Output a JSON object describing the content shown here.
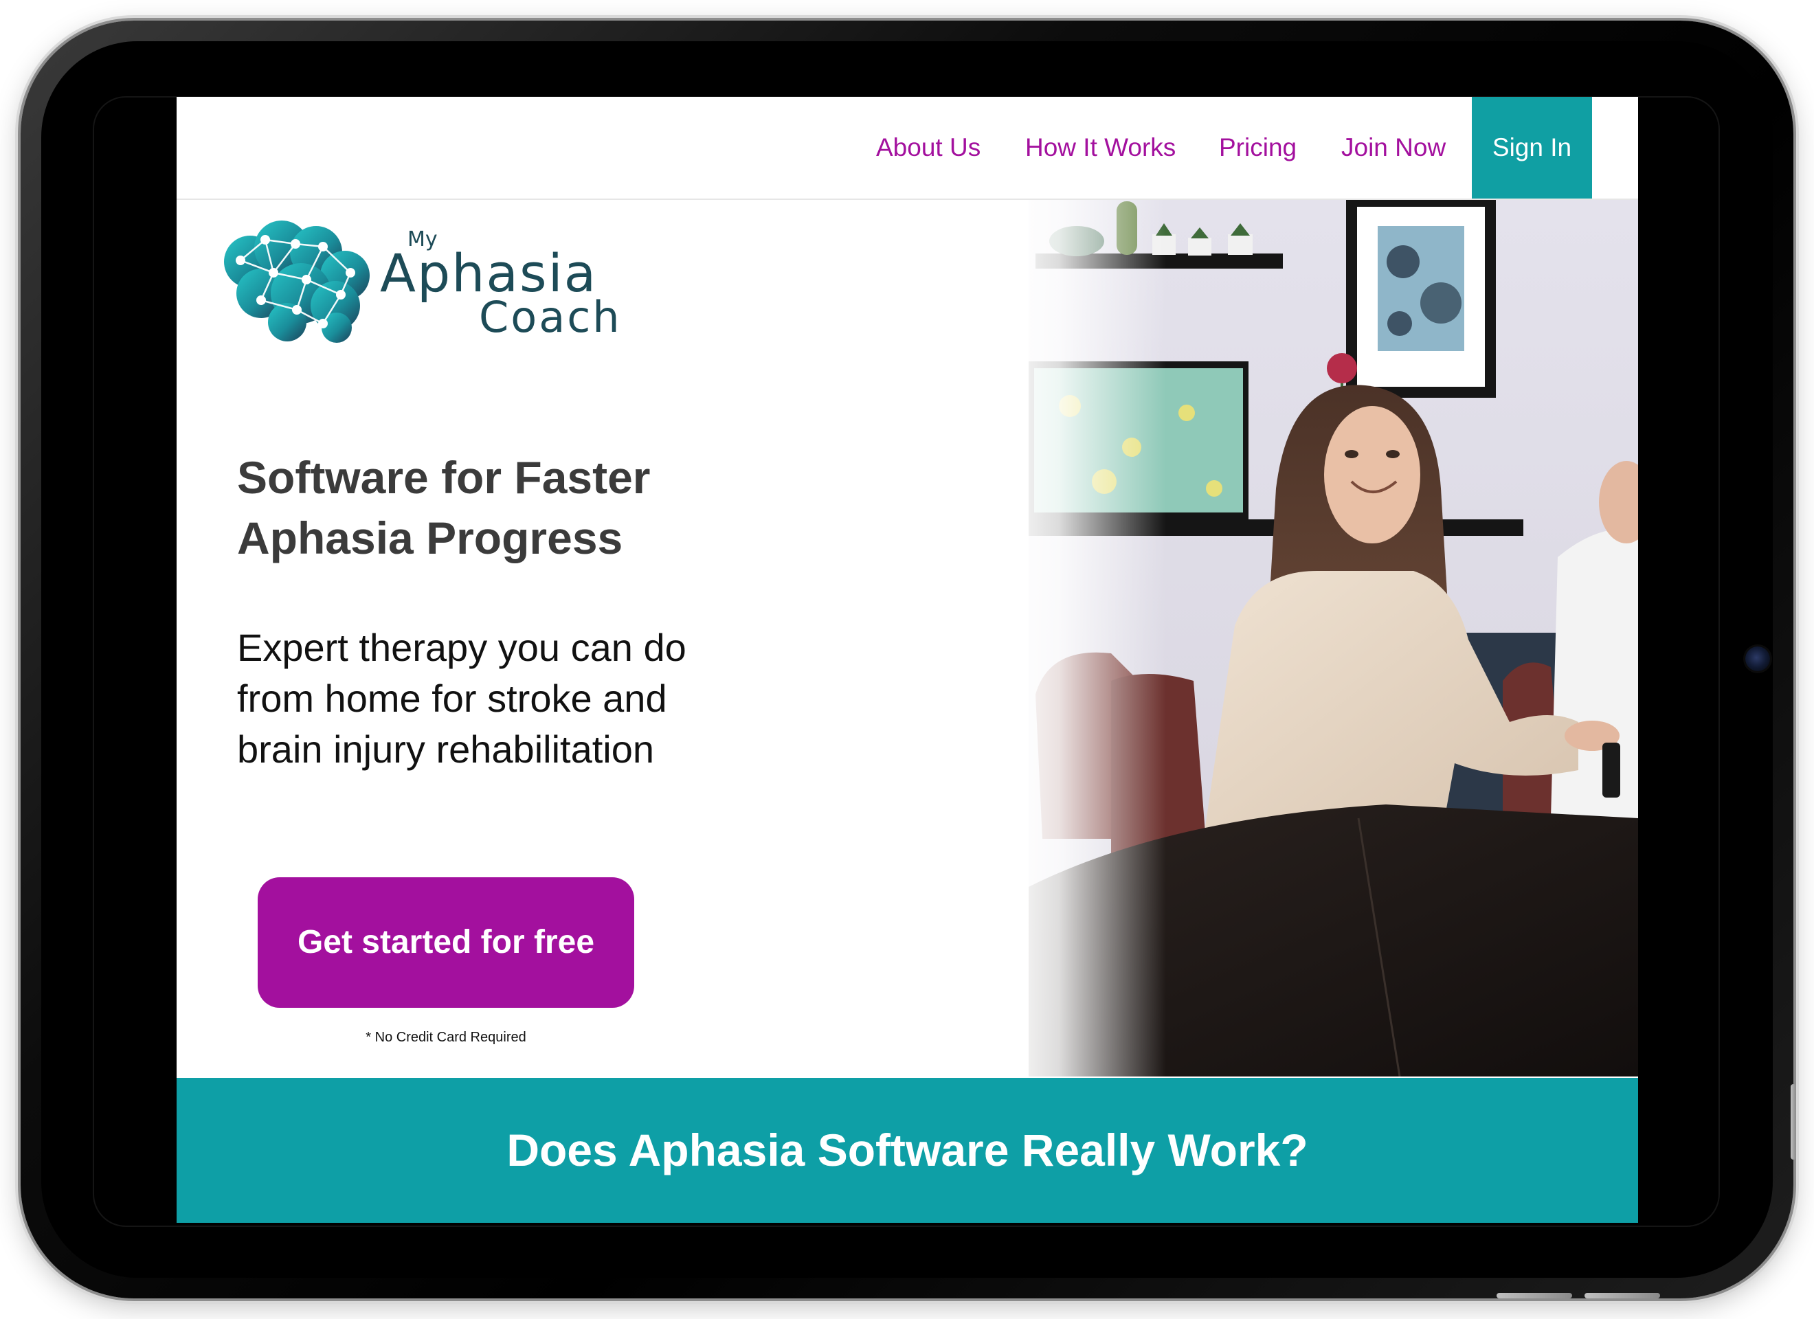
{
  "nav": {
    "items": [
      {
        "label": "About Us"
      },
      {
        "label": "How It Works"
      },
      {
        "label": "Pricing"
      },
      {
        "label": "Join Now"
      }
    ],
    "sign_in": "Sign In"
  },
  "logo": {
    "my": "My",
    "aphasia": "Aphasia",
    "coach": "Coach"
  },
  "hero": {
    "headline_line1": "Software for Faster",
    "headline_line2": "Aphasia Progress",
    "sub_line1": "Expert therapy you can do",
    "sub_line2": "from home for stroke and",
    "sub_line3": "brain injury rehabilitation",
    "cta_label": "Get started for free",
    "cta_note": "* No Credit Card Required"
  },
  "banner": {
    "title": "Does Aphasia Software Really Work?"
  },
  "colors": {
    "nav_link": "#a3109e",
    "accent_teal": "#109fa3",
    "cta_purple": "#a3109e",
    "logo_text": "#1d4b57"
  },
  "icons": {
    "logo": "brain-network-icon",
    "camera": "front-camera-icon"
  }
}
